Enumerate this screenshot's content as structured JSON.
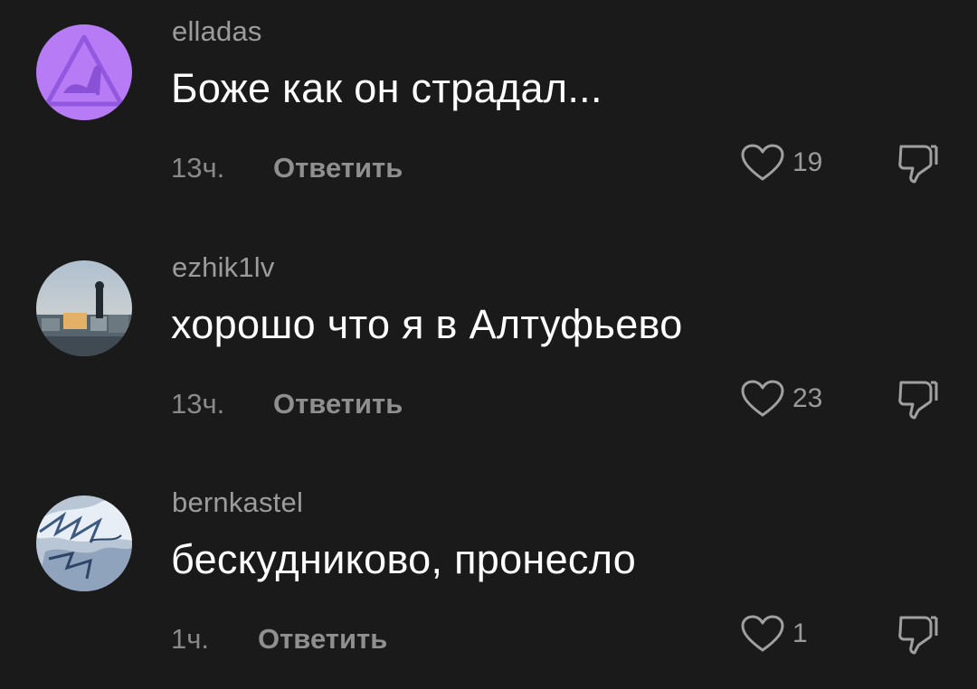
{
  "comments": [
    {
      "username": "elladas",
      "text": "Боже как он страдал...",
      "time": "13ч.",
      "reply_label": "Ответить",
      "likes": "19",
      "avatar": {
        "icon": "high-heel-warning-icon",
        "bg": "#b77cf5",
        "fg": "#8a50d6"
      }
    },
    {
      "username": "ezhik1lv",
      "text": "хорошо что я в Алтуфьево",
      "time": "13ч.",
      "reply_label": "Ответить",
      "likes": "23",
      "avatar": {
        "icon": "rooftop-photo",
        "bg": "#7f8f9f"
      }
    },
    {
      "username": "bernkastel",
      "text": "бескудниково, пронесло",
      "time": "1ч.",
      "reply_label": "Ответить",
      "likes": "1",
      "avatar": {
        "icon": "anime-drawing",
        "bg": "#b9c6d6"
      }
    }
  ],
  "icons": {
    "like": "heart-icon",
    "dislike": "thumbs-down-icon"
  },
  "colors": {
    "background": "#1a1a1a",
    "username": "#9c9c9c",
    "text": "#ffffff",
    "meta": "#8a8a8a"
  }
}
